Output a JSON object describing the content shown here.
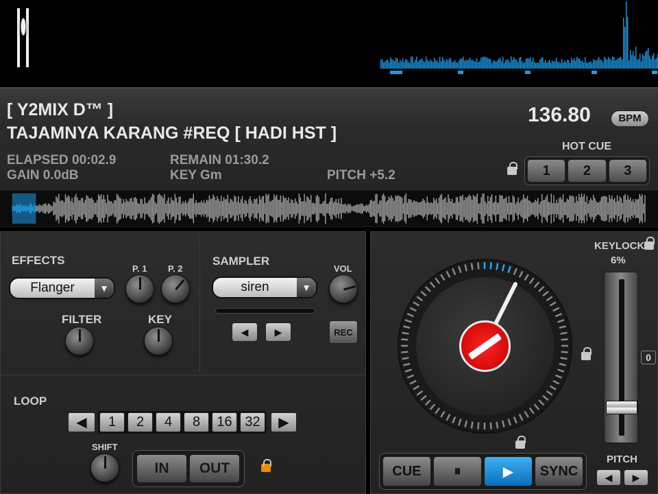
{
  "track": {
    "deck_name": "[ Y2MIX D™ ]",
    "title": "TAJAMNYA KARANG #REQ [ HADI HST ]",
    "elapsed": "ELAPSED 00:02.9",
    "remain": "REMAIN 01:30.2",
    "gain": "GAIN 0.0dB",
    "key": "KEY Gm",
    "pitch": "PITCH +5.2",
    "bpm_value": "136.80",
    "bpm_label": "BPM"
  },
  "hot_cue": {
    "label": "HOT CUE",
    "buttons": [
      "1",
      "2",
      "3"
    ]
  },
  "effects": {
    "label": "EFFECTS",
    "selected": "Flanger",
    "p1_label": "P. 1",
    "p2_label": "P. 2",
    "filter_label": "FILTER",
    "key_label": "KEY"
  },
  "sampler": {
    "label": "SAMPLER",
    "selected": "siren",
    "vol_label": "VOL",
    "prev_glyph": "◀",
    "next_glyph": "▶",
    "rec_label": "REC"
  },
  "loop": {
    "label": "LOOP",
    "prev_glyph": "◀",
    "next_glyph": "▶",
    "sizes": [
      "1",
      "2",
      "4",
      "8",
      "16",
      "32"
    ],
    "shift_label": "SHIFT",
    "in_label": "IN",
    "out_label": "OUT"
  },
  "deck": {
    "keylock_label": "KEYLOCK",
    "keylock_range": "6%",
    "pitch_zero": "0",
    "pitch_label": "PITCH",
    "pitch_prev_glyph": "◀",
    "pitch_next_glyph": "▶",
    "cue_label": "CUE",
    "pause_glyph": "⏸",
    "play_glyph": "▶",
    "sync_label": "SYNC",
    "pitch_fader_position": 0.86
  },
  "colors": {
    "accent": "#29a8f0",
    "record_red": "#e01010",
    "lock_orange": "#f08a00"
  },
  "icons": [
    "lock-icon",
    "triangle-down-icon",
    "triangle-left-icon",
    "triangle-right-icon",
    "pause-icon",
    "play-icon"
  ]
}
